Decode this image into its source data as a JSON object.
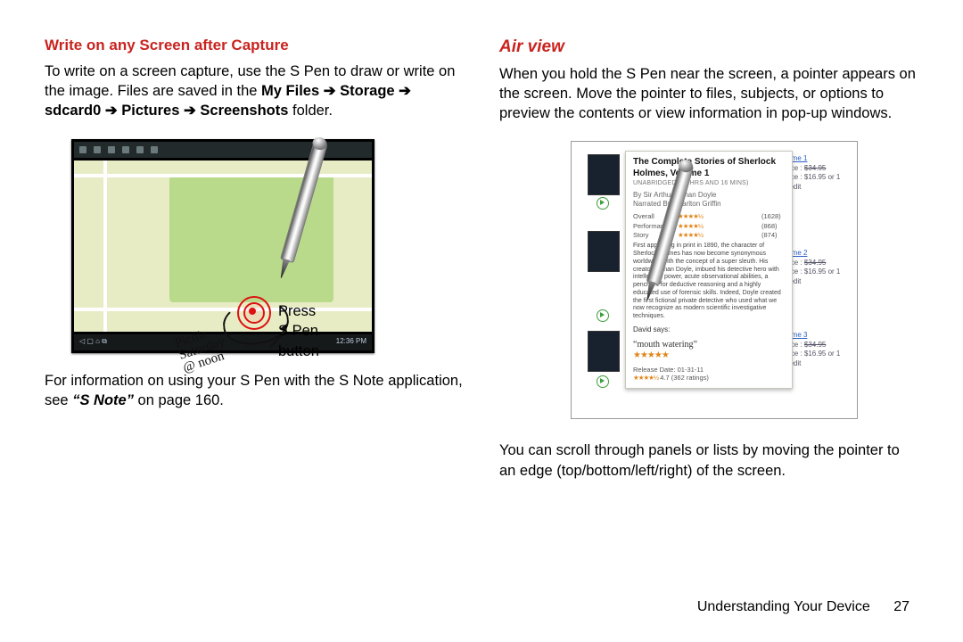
{
  "left": {
    "heading": "Write on any Screen after Capture",
    "para1a": "To write on a screen capture, use the S Pen to draw or write on the image. Files are saved in the ",
    "path": "My Files ➔ Storage ➔ sdcard0 ➔ Pictures ➔ Screenshots",
    "para1b": " folder.",
    "caption_l1": "Press",
    "caption_l2": "S Pen",
    "caption_l3": "button",
    "hand_l1": "Picnic",
    "hand_l2": "Saturday",
    "hand_l3": "@ noon",
    "status_time": "12:36 PM",
    "para2a": "For information on using your S Pen with the S Note application, see ",
    "para2ref": "“S Note”",
    "para2b": " on page 160."
  },
  "right": {
    "heading": "Air view",
    "para1": "When you hold the S Pen near the screen, a pointer appears on the screen. Move the pointer to files, subjects, or options to preview the contents or view information in pop-up windows.",
    "para2": "You can scroll through panels or lists by moving the pointer to an edge (top/bottom/left/right) of the screen.",
    "popup": {
      "title": "The Complete Stories of Sherlock Holmes, Volume 1",
      "sub": "UNABRIDGED (28 HRS AND 16 MINS)",
      "by": "By Sir Arthur Conan Doyle",
      "narr": "Narrated By Charlton Griffin",
      "ratings": {
        "overall_l": "Overall",
        "overall_n": "(1628)",
        "perf_l": "Performance",
        "perf_n": "(868)",
        "story_l": "Story",
        "story_n": "(874)"
      },
      "desc": "First appearing in print in 1890, the character of Sherlock Holmes has now become synonymous worldwide with the concept of a super sleuth. His creator, Conan Doyle, imbued his detective hero with intellectual power, acute observational abilities, a penchant for deductive reasoning and a highly educated use of forensic skills. Indeed, Doyle created the first fictional private detective who used what we now recognize as modern scientific investigative techniques.",
      "david": "David  says:",
      "quote": "“mouth watering”",
      "rel": "Release Date: 01-31-11",
      "rcount": "4.7 (362 ratings)"
    },
    "side": {
      "v1": "olume 1",
      "v2": "olume 2",
      "v3": "olume 3",
      "price_l": "Price : ",
      "price_old": "$34.95",
      "price_new": "Price : $16.95 or 1 Credit"
    }
  },
  "footer": {
    "section": "Understanding Your Device",
    "page": "27"
  }
}
